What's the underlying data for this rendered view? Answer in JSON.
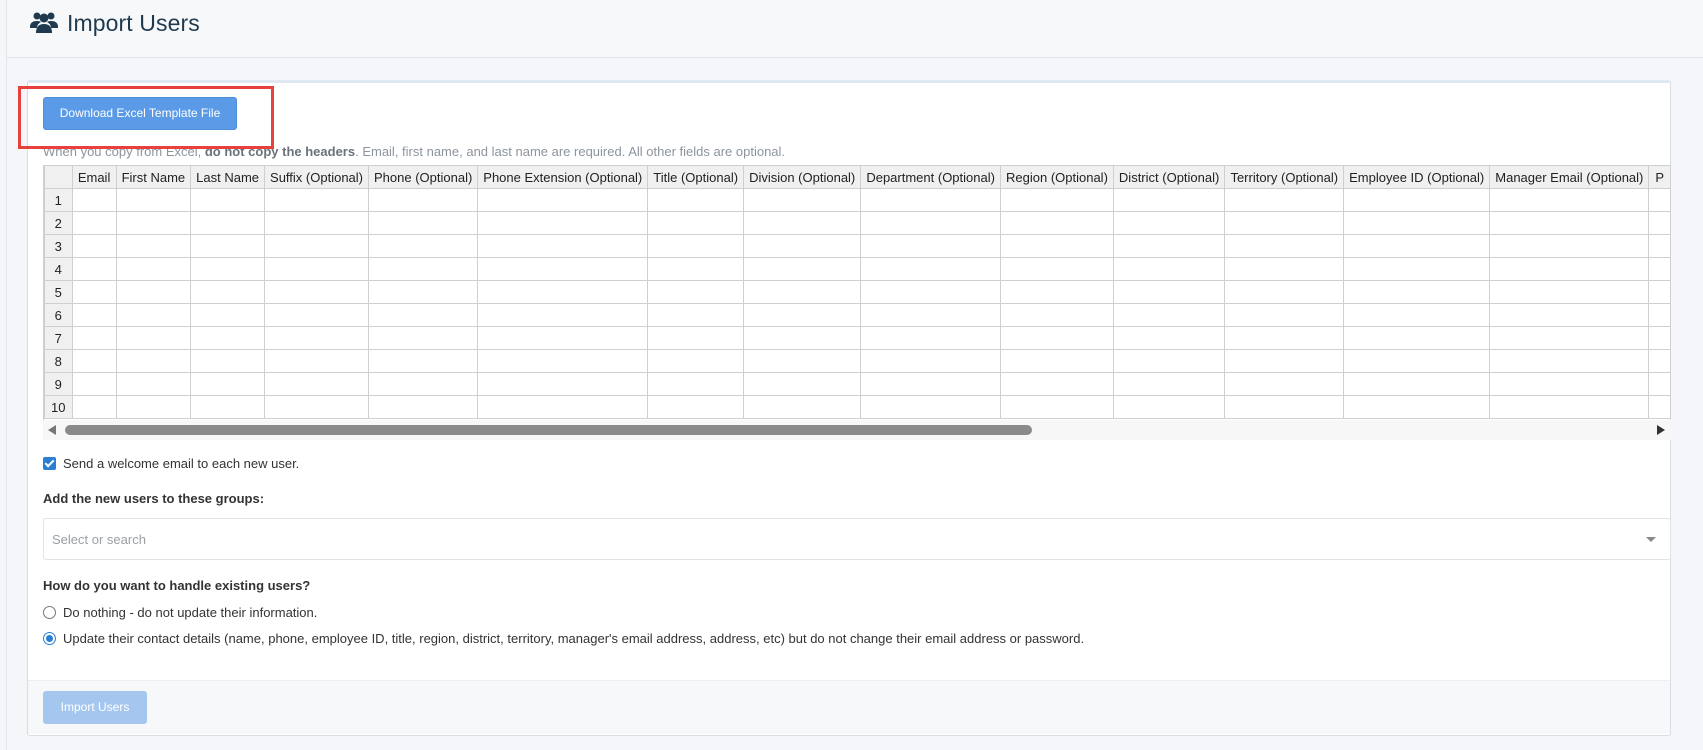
{
  "header": {
    "title": "Import Users",
    "icon": "users-icon"
  },
  "download_button": "Download Excel Template File",
  "hint": {
    "part1": "When you copy from Excel, ",
    "bold": "do not copy the headers",
    "part2": ". Email, first name, and last name are required. All other fields are optional."
  },
  "grid": {
    "columns": [
      "Email",
      "First Name",
      "Last Name",
      "Suffix (Optional)",
      "Phone (Optional)",
      "Phone Extension (Optional)",
      "Title (Optional)",
      "Division (Optional)",
      "Department (Optional)",
      "Region (Optional)",
      "District (Optional)",
      "Territory (Optional)",
      "Employee ID (Optional)",
      "Manager Email (Optional)",
      "P"
    ],
    "rows": [
      "1",
      "2",
      "3",
      "4",
      "5",
      "6",
      "7",
      "8",
      "9",
      "10"
    ]
  },
  "welcome_email": {
    "label": "Send a welcome email to each new user.",
    "checked": true
  },
  "groups": {
    "label": "Add the new users to these groups:",
    "placeholder": "Select or search"
  },
  "existing_users": {
    "question": "How do you want to handle existing users?",
    "options": [
      {
        "label": "Do nothing - do not update their information.",
        "selected": false
      },
      {
        "label": "Update their contact details (name, phone, employee ID, title, region, district, territory, manager's email address, address, etc) but do not change their email address or password.",
        "selected": true
      }
    ]
  },
  "import_button": "Import Users",
  "colors": {
    "primary": "#5b9ae6",
    "highlight": "#e8413d",
    "disabled": "#a4c6ef",
    "title": "#1f3a4f"
  }
}
